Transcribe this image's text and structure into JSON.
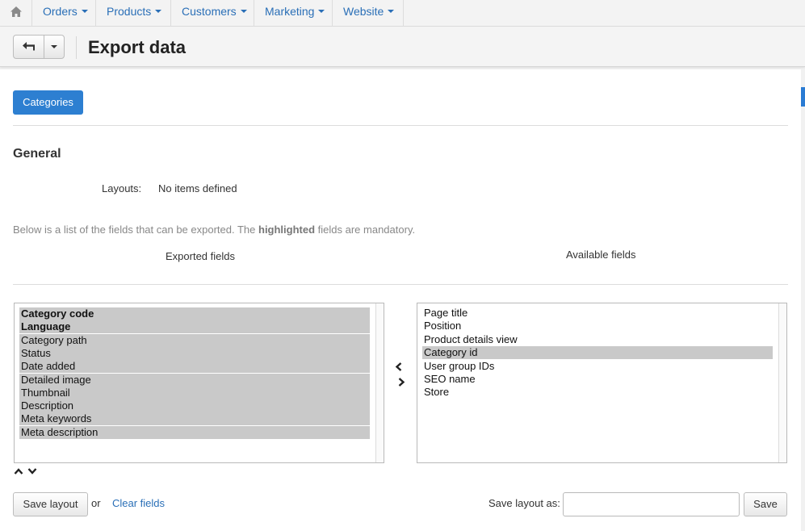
{
  "nav": {
    "home_icon": "home-icon",
    "items": [
      {
        "label": "Orders"
      },
      {
        "label": "Products"
      },
      {
        "label": "Customers"
      },
      {
        "label": "Marketing"
      },
      {
        "label": "Website"
      }
    ]
  },
  "header": {
    "title": "Export data",
    "back_icon": "back-arrow-icon"
  },
  "tabs": [
    {
      "label": "Categories",
      "active": true
    }
  ],
  "general": {
    "title": "General",
    "layouts_label": "Layouts:",
    "layouts_value": "No items defined"
  },
  "info": {
    "prefix": "Below is a list of the fields that can be exported. The ",
    "highlight": "highlighted",
    "suffix": " fields are mandatory."
  },
  "exported": {
    "header": "Exported fields",
    "items": [
      {
        "label": "Category code",
        "mandatory": true
      },
      {
        "label": "Language",
        "mandatory": true
      },
      {
        "label": "Category path",
        "mandatory": false
      },
      {
        "label": "Status",
        "mandatory": false
      },
      {
        "label": "Date added",
        "mandatory": false
      },
      {
        "label": "Detailed image",
        "mandatory": false
      },
      {
        "label": "Thumbnail",
        "mandatory": false
      },
      {
        "label": "Description",
        "mandatory": false
      },
      {
        "label": "Meta keywords",
        "mandatory": false
      },
      {
        "label": "Meta description",
        "mandatory": false
      }
    ]
  },
  "available": {
    "header": "Available fields",
    "items": [
      {
        "label": "Page title",
        "selected": false
      },
      {
        "label": "Position",
        "selected": false
      },
      {
        "label": "Product details view",
        "selected": false
      },
      {
        "label": "Category id",
        "selected": true
      },
      {
        "label": "User group IDs",
        "selected": false
      },
      {
        "label": "SEO name",
        "selected": false
      },
      {
        "label": "Store",
        "selected": false
      }
    ]
  },
  "footer": {
    "save_layout": "Save layout",
    "or": "or",
    "clear_fields": "Clear fields",
    "save_as_label": "Save layout as:",
    "save_as_value": "",
    "save": "Save"
  },
  "colors": {
    "accent": "#2d7fd1",
    "link": "#2a6fb7",
    "selected_bg": "#c9c9c9"
  }
}
